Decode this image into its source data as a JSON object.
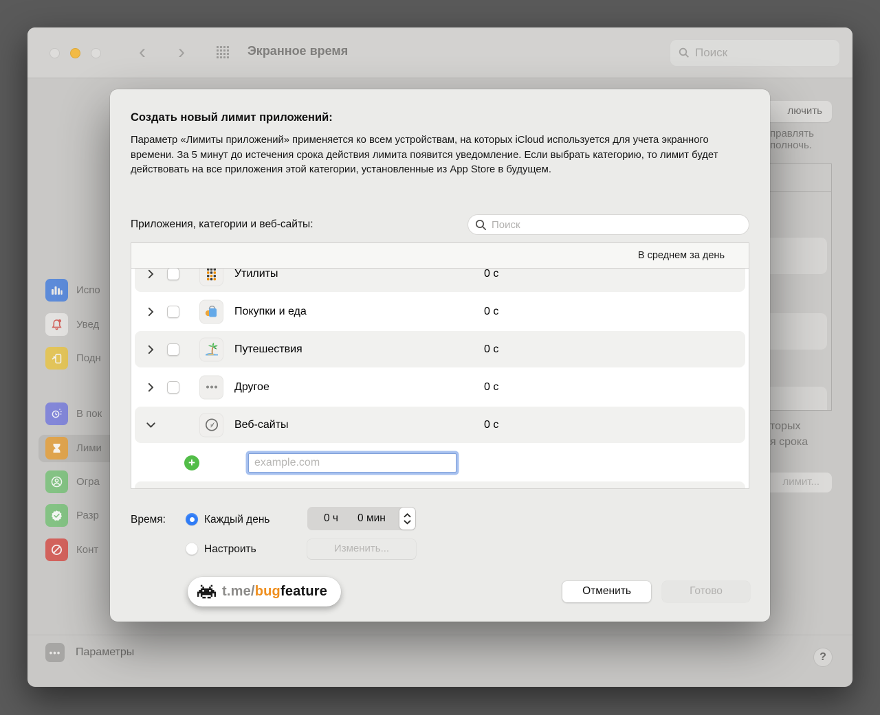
{
  "colors": {
    "accent_blue": "#2f7cf6",
    "plus_green": "#52bd48",
    "badge_orange": "#ef8f1f"
  },
  "titlebar": {
    "title": "Экранное время",
    "search_placeholder": "Поиск"
  },
  "sidebar": {
    "items": [
      {
        "label": "Испо"
      },
      {
        "label": "Увед"
      },
      {
        "label": "Подн"
      },
      {
        "label": "В пок"
      },
      {
        "label": "Лими"
      },
      {
        "label": "Огра"
      },
      {
        "label": "Разр"
      },
      {
        "label": "Конт"
      }
    ],
    "options_label": "Параметры"
  },
  "background_panel": {
    "enable_button": "лючить",
    "line1": "правлять",
    "line2": "полночь.",
    "line3": "торых",
    "line4": "я срока",
    "limit_button": "лимит..."
  },
  "help_button": "?",
  "dialog": {
    "title": "Создать новый лимит приложений:",
    "description": "Параметр «Лимиты приложений» применяется ко всем устройствам, на которых iCloud используется для учета экранного времени. За 5 минут до истечения срока действия лимита появится уведомление. Если выбрать категорию, то лимит будет действовать на все приложения этой категории, установленные из App Store в будущем.",
    "list_label": "Приложения, категории и веб-сайты:",
    "search_placeholder": "Поиск",
    "table": {
      "header": "В среднем за день",
      "rows": [
        {
          "label": "Утилиты",
          "value": "0 с"
        },
        {
          "label": "Покупки и еда",
          "value": "0 с"
        },
        {
          "label": "Путешествия",
          "value": "0 с"
        },
        {
          "label": "Другое",
          "value": "0 с"
        },
        {
          "label": "Веб-сайты",
          "value": "0 с"
        }
      ],
      "website_placeholder": "example.com"
    },
    "time": {
      "label": "Время:",
      "every_day": "Каждый день",
      "custom": "Настроить",
      "hours": "0 ч",
      "minutes": "0 мин",
      "edit_button": "Изменить..."
    },
    "badge": {
      "prefix": "t.me/",
      "bug": "bug",
      "feature": "feature"
    },
    "cancel": "Отменить",
    "done": "Готово"
  }
}
